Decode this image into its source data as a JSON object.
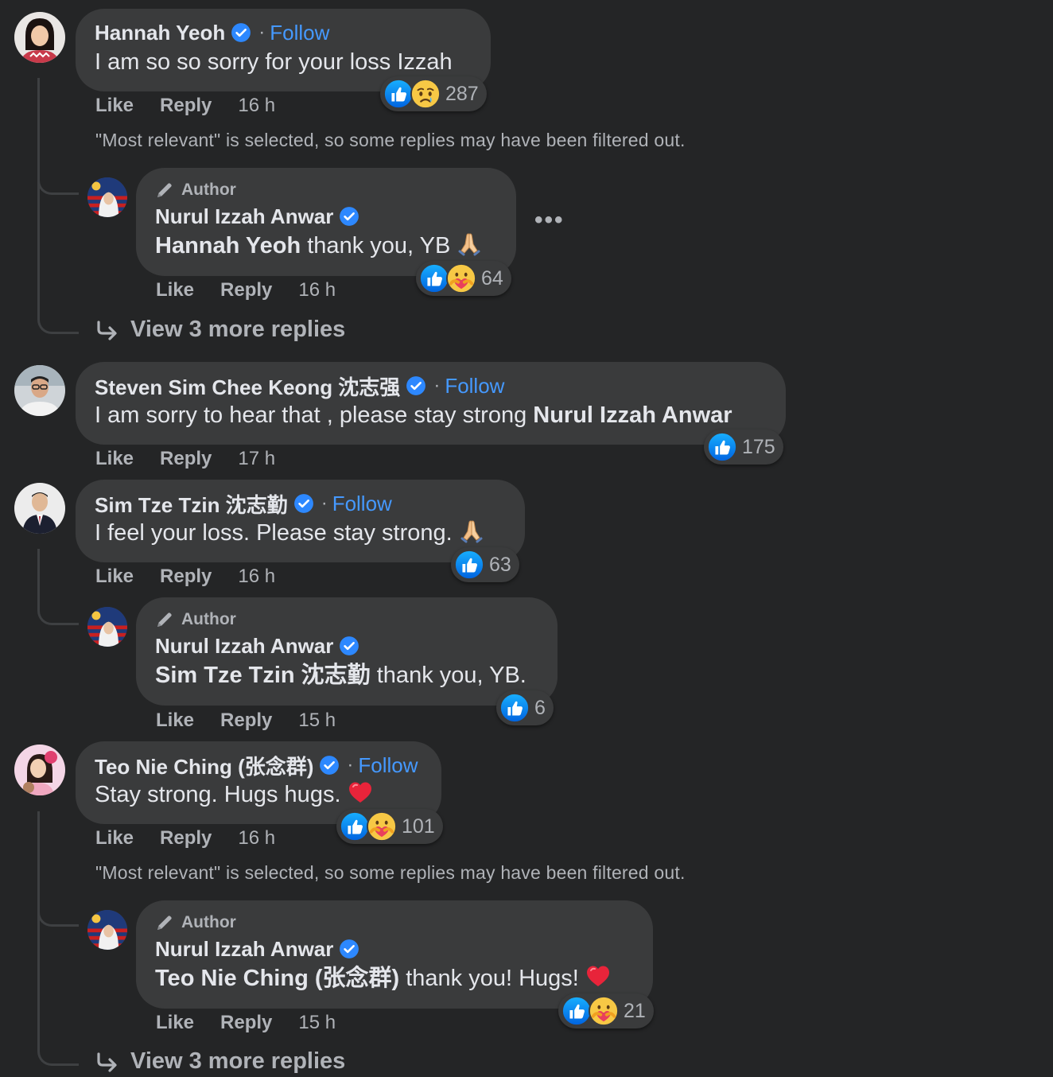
{
  "labels": {
    "like": "Like",
    "reply": "Reply",
    "follow": "Follow",
    "author": "Author",
    "separator": "·",
    "more_options": "•••",
    "filtered_notice": "\"Most relevant\" is selected, so some replies may have been filtered out."
  },
  "comments": [
    {
      "name": "Hannah Yeoh",
      "text": "I am so so sorry for your loss Izzah",
      "time": "16 h",
      "reaction_count": "287",
      "reactions": [
        "like-icon",
        "sad-icon"
      ],
      "verified": true,
      "show_filtered_notice": true,
      "reply": {
        "name": "Nurul Izzah Anwar",
        "mention": "Hannah Yeoh",
        "text": "thank you, YB",
        "emoji": "folded-hands-icon",
        "time": "16 h",
        "reaction_count": "64",
        "reactions": [
          "like-icon",
          "care-icon"
        ]
      },
      "view_more": "View 3 more replies"
    },
    {
      "name": "Steven Sim Chee Keong 沈志强",
      "text": "I am sorry to hear that , please stay strong",
      "mention_end": "Nurul Izzah Anwar",
      "time": "17 h",
      "reaction_count": "175",
      "reactions": [
        "like-icon"
      ]
    },
    {
      "name": "Sim Tze Tzin 沈志勤",
      "text": "I feel your loss. Please stay strong.",
      "emoji": "folded-hands-icon",
      "time": "16 h",
      "reaction_count": "63",
      "reactions": [
        "like-icon"
      ],
      "reply": {
        "name": "Nurul Izzah Anwar",
        "mention": "Sim Tze Tzin 沈志勤",
        "text": "thank you, YB.",
        "time": "15 h",
        "reaction_count": "6",
        "reactions": [
          "like-icon"
        ]
      }
    },
    {
      "name": "Teo Nie Ching (张念群)",
      "text": "Stay strong. Hugs hugs.",
      "emoji": "heart-icon",
      "time": "16 h",
      "reaction_count": "101",
      "reactions": [
        "like-icon",
        "care-icon"
      ],
      "show_filtered_notice": true,
      "reply": {
        "name": "Nurul Izzah Anwar",
        "mention": "Teo Nie Ching (张念群)",
        "text": "thank you! Hugs!",
        "emoji": "heart-icon",
        "time": "15 h",
        "reaction_count": "21",
        "reactions": [
          "like-icon",
          "care-icon"
        ]
      },
      "view_more": "View 3 more replies"
    }
  ],
  "colors": {
    "background": "#242526",
    "bubble": "#3a3b3c",
    "primary_text": "#e4e6eb",
    "secondary_text": "#b0b3b8",
    "follow_link": "#4599ff",
    "verified_badge": "#2d88ff",
    "like_blue": "#1877f2"
  }
}
